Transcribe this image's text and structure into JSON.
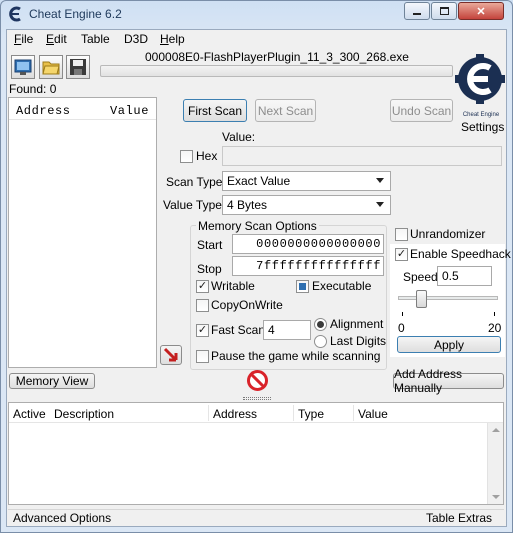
{
  "window": {
    "title": "Cheat Engine 6.2",
    "process": "000008E0-FlashPlayerPlugin_11_3_300_268.exe",
    "found": "Found: 0",
    "settings_label": "Settings",
    "logo_caption": "Cheat Engine"
  },
  "menu": [
    "File",
    "Edit",
    "Table",
    "D3D",
    "Help"
  ],
  "menu_underlines": [
    "F",
    "E",
    "",
    "",
    "H"
  ],
  "results_headers": {
    "address": "Address",
    "value": "Value"
  },
  "scan": {
    "first_scan": "First Scan",
    "next_scan": "Next Scan",
    "undo_scan": "Undo Scan",
    "value_label": "Value:",
    "hex_label": "Hex",
    "hex_checked": false,
    "value_input": "",
    "scan_type_label": "Scan Type",
    "scan_type": "Exact Value",
    "value_type_label": "Value Type",
    "value_type": "4 Bytes"
  },
  "memory_options": {
    "title": "Memory Scan Options",
    "start_label": "Start",
    "start_value": "0000000000000000",
    "stop_label": "Stop",
    "stop_value": "7fffffffffffffff",
    "writable": "Writable",
    "writable_checked": true,
    "executable": "Executable",
    "executable_state": "indeterminate",
    "copy_on_write": "CopyOnWrite",
    "copy_on_write_checked": false,
    "fast_scan": "Fast Scan",
    "fast_scan_checked": true,
    "fast_scan_value": "4",
    "alignment": "Alignment",
    "last_digits": "Last Digits",
    "pause_game": "Pause the game while scanning",
    "pause_checked": false
  },
  "unrandomizer": {
    "label": "Unrandomizer",
    "checked": false
  },
  "speedhack": {
    "enable_label": "Enable Speedhack",
    "enabled": true,
    "speed_label": "Speed",
    "speed_value": "0.5",
    "min": "0",
    "max": "20",
    "slider_value": 0.5,
    "apply": "Apply"
  },
  "bottom": {
    "memory_view": "Memory View",
    "add_address": "Add Address Manually",
    "columns": [
      "Active",
      "Description",
      "Address",
      "Type",
      "Value"
    ],
    "advanced_options": "Advanced Options",
    "table_extras": "Table Extras"
  },
  "colors": {
    "accent_blue": "#2f6fb0",
    "stop_red": "#d9232a",
    "frame": "#cfe0f3"
  },
  "icons": {
    "app": "cheat-engine-icon",
    "open_process": "open-process-icon",
    "open_file": "open-folder-icon",
    "save": "save-disk-icon",
    "pointer": "red-arrow-icon",
    "stop": "stop-sign-icon"
  }
}
